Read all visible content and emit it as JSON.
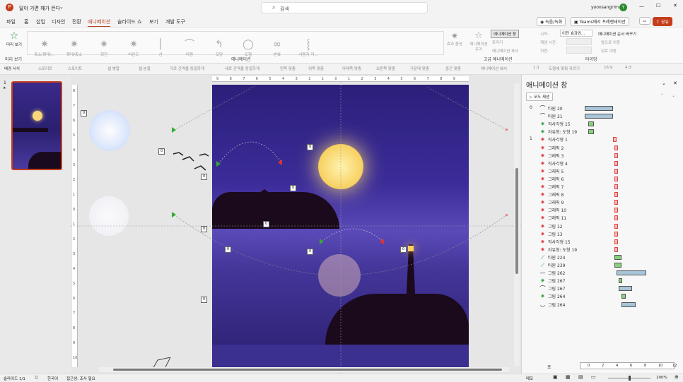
{
  "titlebar": {
    "app_icon": "powerpoint-icon",
    "doc_title": "달이 가면 해가 뜬다",
    "search_placeholder": "검색",
    "user": "yoonsangrim",
    "avatar": "Y",
    "minimize": "—",
    "maximize": "☐",
    "close": "✕"
  },
  "menu": {
    "tabs": [
      "파일",
      "홈",
      "삽입",
      "디자인",
      "전환",
      "애니메이션",
      "슬라이드 쇼",
      "보기",
      "개발 도구"
    ],
    "active": "애니메이션",
    "record": "녹음/녹화",
    "teams": "Teams에서 프레젠테이션",
    "comment_icon": "comment-icon",
    "share": "공유"
  },
  "ribbon": {
    "preview_label": "미리 보기",
    "preview_group": "미리 보기",
    "effects": [
      "축소/확대/...",
      "확대/축소",
      "회전",
      "바운드",
      "선",
      "타원",
      "모양",
      "도형",
      "반복",
      "사용자 지..."
    ],
    "effect_options": "효과 옵션",
    "animation_group": "애니메이션",
    "add_animation": "애니메이션 추가",
    "anim_pane": "애니메이션 창",
    "trigger": "트리거",
    "painter": "애니메이션 복사",
    "advanced_group": "고급 애니메이션",
    "start_label": "시작:",
    "start_value": "이전 효과와...",
    "duration_label": "재생 시간:",
    "delay_label": "지연:",
    "reorder_title": "애니메이션 순서 바꾸기",
    "move_earlier": "앞으로 이동",
    "move_later": "뒤로 이동",
    "timing_group": "타이밍"
  },
  "toolbar2": {
    "items": [
      "배경 서식",
      "스포이트",
      "스포이트",
      "셀 병합",
      "셀 분할",
      "가로 간격을 동일하게",
      "세로 간격을 동일하게",
      "왼쪽 맞춤",
      "위쪽 맞춤",
      "아래쪽 맞춤",
      "오른쪽 맞춤",
      "가운데 맞춤",
      "중간 맞춤",
      "애니메이션 복사",
      "1:1",
      "도형에 맞춰 자르기",
      "16:9",
      "4:3"
    ]
  },
  "thumbs": {
    "slide_number": "1",
    "star": "★"
  },
  "canvas": {
    "ruler_top": [
      "9",
      "8",
      "7",
      "6",
      "5",
      "4",
      "3",
      "2",
      "1",
      "0",
      "1",
      "2",
      "3",
      "4",
      "5",
      "6",
      "7",
      "8",
      "9"
    ],
    "ruler_left": [
      "8",
      "7",
      "6",
      "5",
      "4",
      "3",
      "2",
      "1",
      "0",
      "1",
      "2",
      "3",
      "4",
      "5",
      "6",
      "7",
      "8",
      "9",
      "10"
    ],
    "tags": [
      "0",
      "0",
      "0",
      "0",
      "0",
      "0",
      "0",
      "0",
      "0",
      "0",
      "0"
    ]
  },
  "anim_pane": {
    "title": "애니메이션 창",
    "play_all": "모두 재생",
    "rows": [
      {
        "num": "0",
        "icon": "arc-icon",
        "label": "타원 20",
        "color": "blue",
        "start": 826,
        "len": 40
      },
      {
        "num": "",
        "icon": "arc-icon",
        "label": "타원 21",
        "color": "blue",
        "start": 826,
        "len": 40
      },
      {
        "num": "",
        "icon": "star-green-icon",
        "label": "직사각형 15",
        "color": "green",
        "start": 831,
        "len": 8
      },
      {
        "num": "",
        "icon": "star-green-icon",
        "label": "자유형: 도형 19",
        "color": "green",
        "start": 831,
        "len": 8
      },
      {
        "num": "1",
        "icon": "star-red-icon",
        "label": "직사각형 1",
        "color": "red",
        "start": 866,
        "len": 5
      },
      {
        "num": "",
        "icon": "star-red-icon",
        "label": "그래픽 2",
        "color": "red",
        "start": 868,
        "len": 5
      },
      {
        "num": "",
        "icon": "star-red-icon",
        "label": "그래픽 3",
        "color": "red",
        "start": 868,
        "len": 5
      },
      {
        "num": "",
        "icon": "star-red-icon",
        "label": "직사각형 4",
        "color": "red",
        "start": 868,
        "len": 5
      },
      {
        "num": "",
        "icon": "star-red-icon",
        "label": "그래픽 5",
        "color": "red",
        "start": 868,
        "len": 5
      },
      {
        "num": "",
        "icon": "star-red-icon",
        "label": "그래픽 6",
        "color": "red",
        "start": 868,
        "len": 5
      },
      {
        "num": "",
        "icon": "star-red-icon",
        "label": "그래픽 7",
        "color": "red",
        "start": 868,
        "len": 5
      },
      {
        "num": "",
        "icon": "star-red-icon",
        "label": "그래픽 8",
        "color": "red",
        "start": 868,
        "len": 5
      },
      {
        "num": "",
        "icon": "star-red-icon",
        "label": "그래픽 9",
        "color": "red",
        "start": 868,
        "len": 5
      },
      {
        "num": "",
        "icon": "star-red-icon",
        "label": "그래픽 10",
        "color": "red",
        "start": 868,
        "len": 5
      },
      {
        "num": "",
        "icon": "star-red-icon",
        "label": "그래픽 11",
        "color": "red",
        "start": 868,
        "len": 5
      },
      {
        "num": "",
        "icon": "star-red-icon",
        "label": "그림 12",
        "color": "red",
        "start": 868,
        "len": 5
      },
      {
        "num": "",
        "icon": "star-red-icon",
        "label": "그림 13",
        "color": "red",
        "start": 868,
        "len": 5
      },
      {
        "num": "",
        "icon": "star-red-icon",
        "label": "직사각형 15",
        "color": "red",
        "start": 868,
        "len": 5
      },
      {
        "num": "",
        "icon": "star-red-icon",
        "label": "자유형: 도형 19",
        "color": "red",
        "start": 868,
        "len": 5
      },
      {
        "num": "",
        "icon": "line-green-icon",
        "label": "타원 224",
        "color": "green",
        "start": 868,
        "len": 10
      },
      {
        "num": "",
        "icon": "line-green-icon",
        "label": "타원 239",
        "color": "green",
        "start": 868,
        "len": 10
      },
      {
        "num": "",
        "icon": "line-icon",
        "label": "그림 262",
        "color": "blue",
        "start": 871,
        "len": 42
      },
      {
        "num": "",
        "icon": "star-green-icon",
        "label": "그림 267",
        "color": "green",
        "start": 874,
        "len": 5
      },
      {
        "num": "",
        "icon": "arc-icon",
        "label": "그림 267",
        "color": "blue",
        "start": 874,
        "len": 19
      },
      {
        "num": "",
        "icon": "star-green-icon",
        "label": "그림 264",
        "color": "green",
        "start": 878,
        "len": 6
      },
      {
        "num": "",
        "icon": "turn-icon",
        "label": "그림 264",
        "color": "blue",
        "start": 878,
        "len": 20
      }
    ],
    "seconds_label": "초",
    "timeline": [
      "0",
      "2",
      "4",
      "6",
      "8",
      "10",
      "12"
    ]
  },
  "status": {
    "slide": "슬라이드 1/1",
    "lang": "한국어",
    "access": "접근성: 조사 필요",
    "notes": "메모",
    "zoom": "100%"
  }
}
